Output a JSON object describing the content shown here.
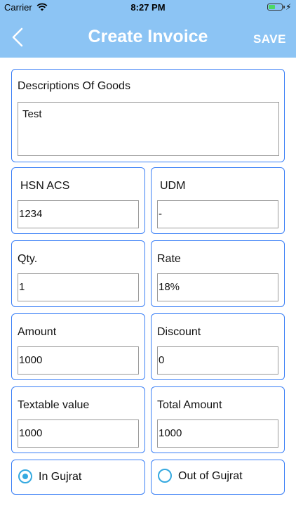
{
  "status_bar": {
    "carrier": "Carrier",
    "time": "8:27 PM",
    "battery_level": 0.5,
    "battery_color": "#4cd964"
  },
  "nav": {
    "back_icon": "chevron-left-icon",
    "title": "Create Invoice",
    "save_label": "SAVE",
    "bar_color": "#8cc4f4"
  },
  "form": {
    "description": {
      "label": "Descriptions Of Goods",
      "value": "Test"
    },
    "hsn": {
      "label": "HSN ACS",
      "value": "1234"
    },
    "udm": {
      "label": "UDM",
      "value": "-"
    },
    "qty": {
      "label": "Qty.",
      "value": "1"
    },
    "rate": {
      "label": "Rate",
      "value": "18%"
    },
    "amount": {
      "label": "Amount",
      "value": "1000"
    },
    "discount": {
      "label": "Discount",
      "value": "0"
    },
    "taxable_value": {
      "label": "Textable value",
      "value": "1000"
    },
    "total_amount": {
      "label": "Total Amount",
      "value": "1000"
    }
  },
  "location": {
    "options": [
      {
        "label": "In Gujrat",
        "selected": true
      },
      {
        "label": "Out of Gujrat",
        "selected": false
      }
    ]
  },
  "accent_color": "#3a7ff6"
}
